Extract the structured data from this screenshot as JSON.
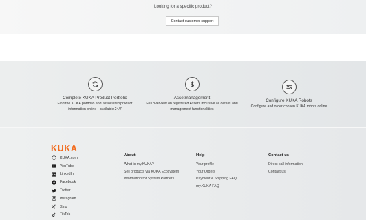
{
  "support": {
    "question": "Looking for a specific product?",
    "button_label": "Contact customer support"
  },
  "features": [
    {
      "icon": "refresh-icon",
      "title": "Complete KUKA Product Portfolio",
      "desc1": "Find the KUKA portfolio and associated product",
      "desc2": "information online - available 24/7"
    },
    {
      "icon": "dollar-icon",
      "title": "Assetmanagement",
      "desc1": "Full overview on registered Assets inclusive all details and",
      "desc2": "management functionalities"
    },
    {
      "icon": "sliders-icon",
      "title": "Configure KUKA Robots",
      "desc1": "Configure and order chosen KUKA robots online",
      "desc2": ""
    }
  ],
  "footer": {
    "brand": "KUKA",
    "brand_color": "#f26b1d",
    "social": [
      {
        "icon": "globe-icon",
        "label": "KUKA.com"
      },
      {
        "icon": "youtube-icon",
        "label": "YouTube"
      },
      {
        "icon": "linkedin-icon",
        "label": "LinkedIn"
      },
      {
        "icon": "facebook-icon",
        "label": "Facebook"
      },
      {
        "icon": "twitter-icon",
        "label": "Twitter"
      },
      {
        "icon": "instagram-icon",
        "label": "Instagram"
      },
      {
        "icon": "xing-icon",
        "label": "Xing"
      },
      {
        "icon": "tiktok-icon",
        "label": "TikTok"
      }
    ],
    "columns": [
      {
        "heading": "About",
        "links": [
          "What is my.KUKA?",
          "Sell products via KUKA Ecosystem",
          "Information for System Partners"
        ]
      },
      {
        "heading": "Help",
        "links": [
          "Your profile",
          "Your Orders",
          "Payment & Shipping FAQ",
          "my.KUKA FAQ"
        ]
      },
      {
        "heading": "Contact us",
        "links": [
          "Direct call information",
          "Contact us"
        ]
      }
    ]
  }
}
